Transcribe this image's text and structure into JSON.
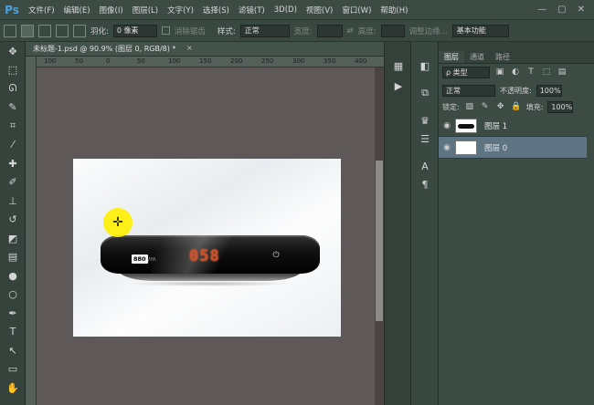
{
  "app": {
    "logo": "Ps",
    "menu": [
      "文件(F)",
      "编辑(E)",
      "图像(I)",
      "图层(L)",
      "文字(Y)",
      "选择(S)",
      "滤镜(T)",
      "3D(D)",
      "视图(V)",
      "窗口(W)",
      "帮助(H)"
    ],
    "window_controls": [
      "—",
      "▢",
      "✕"
    ]
  },
  "options_bar": {
    "feather_label": "羽化:",
    "feather_value": "0 像素",
    "antialias_label": "消除锯齿",
    "style_label": "样式:",
    "style_value": "正常",
    "width_label": "宽度:",
    "height_label": "高度:",
    "refine_edge": "调整边缘...",
    "workspace": "基本功能"
  },
  "document": {
    "tab_title": "未标题-1.psd @ 90.9% (图层 0, RGB/8) *",
    "close": "×",
    "ruler_marks": [
      "100",
      "50",
      "0",
      "50",
      "100",
      "150",
      "200",
      "250",
      "300",
      "350",
      "400"
    ],
    "device_badge": "880",
    "device_badge_tail": "/m",
    "device_digits": "058",
    "power_glyph": "⏻"
  },
  "tools": [
    "move-tool",
    "marquee-tool",
    "lasso-tool",
    "quick-select-tool",
    "crop-tool",
    "eyedropper-tool",
    "healing-tool",
    "brush-tool",
    "clone-stamp-tool",
    "history-brush-tool",
    "eraser-tool",
    "gradient-tool",
    "blur-tool",
    "dodge-tool",
    "pen-tool",
    "type-tool",
    "path-select-tool",
    "shape-tool",
    "hand-tool"
  ],
  "layers_panel": {
    "tabs": [
      "图层",
      "通道",
      "路径"
    ],
    "filter_kind": "ρ 类型",
    "blend_mode": "正常",
    "opacity_label": "不透明度:",
    "opacity_value": "100%",
    "lock_label": "锁定:",
    "fill_label": "填充:",
    "fill_value": "100%",
    "layers": [
      {
        "name": "图层 1"
      },
      {
        "name": "图层 0"
      }
    ]
  }
}
